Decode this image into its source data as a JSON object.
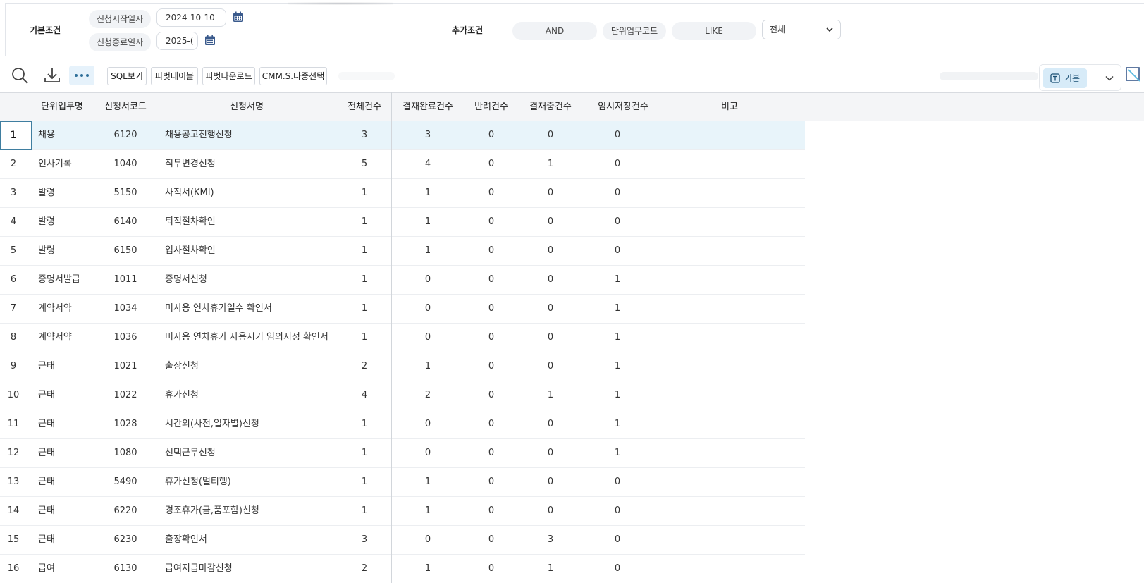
{
  "conditions": {
    "basic_title": "기본조건",
    "start_label": "신청시작일자",
    "start_value": "2024-10-10",
    "end_label": "신청종료일자",
    "end_value": "2025-(",
    "extra_title": "추가조건",
    "logic_value": "AND",
    "field_label": "단위업무코드",
    "operator_value": "LIKE",
    "select_value": "전체"
  },
  "toolbar": {
    "buttons": [
      "SQL보기",
      "피벗테이블",
      "피벗다운로드",
      "CMM.S.다중선택"
    ],
    "view_label": "기본"
  },
  "grid": {
    "headers": {
      "unit": "단위업무명",
      "code": "신청서코드",
      "name": "신청서명",
      "total": "전체건수",
      "done": "결재완료건수",
      "rejected": "반려건수",
      "in_progress": "결재중건수",
      "temp": "임시저장건수",
      "note": "비고"
    },
    "rows": [
      {
        "num": "1",
        "unit": "채용",
        "code": "6120",
        "name": "채용공고진행신청",
        "total": "3",
        "done": "3",
        "rejected": "0",
        "in_progress": "0",
        "temp": "0"
      },
      {
        "num": "2",
        "unit": "인사기록",
        "code": "1040",
        "name": "직무변경신청",
        "total": "5",
        "done": "4",
        "rejected": "0",
        "in_progress": "1",
        "temp": "0"
      },
      {
        "num": "3",
        "unit": "발령",
        "code": "5150",
        "name": "사직서(KMI)",
        "total": "1",
        "done": "1",
        "rejected": "0",
        "in_progress": "0",
        "temp": "0"
      },
      {
        "num": "4",
        "unit": "발령",
        "code": "6140",
        "name": "퇴직절차확인",
        "total": "1",
        "done": "1",
        "rejected": "0",
        "in_progress": "0",
        "temp": "0"
      },
      {
        "num": "5",
        "unit": "발령",
        "code": "6150",
        "name": "입사절차확인",
        "total": "1",
        "done": "1",
        "rejected": "0",
        "in_progress": "0",
        "temp": "0"
      },
      {
        "num": "6",
        "unit": "증명서발급",
        "code": "1011",
        "name": "증명서신청",
        "total": "1",
        "done": "0",
        "rejected": "0",
        "in_progress": "0",
        "temp": "1"
      },
      {
        "num": "7",
        "unit": "계약서약",
        "code": "1034",
        "name": "미사용 연차휴가일수 확인서",
        "total": "1",
        "done": "0",
        "rejected": "0",
        "in_progress": "0",
        "temp": "1"
      },
      {
        "num": "8",
        "unit": "계약서약",
        "code": "1036",
        "name": "미사용 연차휴가 사용시기 임의지정 확인서",
        "total": "1",
        "done": "0",
        "rejected": "0",
        "in_progress": "0",
        "temp": "1"
      },
      {
        "num": "9",
        "unit": "근태",
        "code": "1021",
        "name": "출장신청",
        "total": "2",
        "done": "1",
        "rejected": "0",
        "in_progress": "0",
        "temp": "1"
      },
      {
        "num": "10",
        "unit": "근태",
        "code": "1022",
        "name": "휴가신청",
        "total": "4",
        "done": "2",
        "rejected": "0",
        "in_progress": "1",
        "temp": "1"
      },
      {
        "num": "11",
        "unit": "근태",
        "code": "1028",
        "name": "시간외(사전,일자별)신청",
        "total": "1",
        "done": "0",
        "rejected": "0",
        "in_progress": "0",
        "temp": "1"
      },
      {
        "num": "12",
        "unit": "근태",
        "code": "1080",
        "name": "선택근무신청",
        "total": "1",
        "done": "0",
        "rejected": "0",
        "in_progress": "0",
        "temp": "1"
      },
      {
        "num": "13",
        "unit": "근태",
        "code": "5490",
        "name": "휴가신청(멀티행)",
        "total": "1",
        "done": "1",
        "rejected": "0",
        "in_progress": "0",
        "temp": "0"
      },
      {
        "num": "14",
        "unit": "근태",
        "code": "6220",
        "name": "경조휴가(금,품포함)신청",
        "total": "1",
        "done": "1",
        "rejected": "0",
        "in_progress": "0",
        "temp": "0"
      },
      {
        "num": "15",
        "unit": "근태",
        "code": "6230",
        "name": "출장확인서",
        "total": "3",
        "done": "0",
        "rejected": "0",
        "in_progress": "3",
        "temp": "0"
      },
      {
        "num": "16",
        "unit": "급여",
        "code": "6130",
        "name": "급여지급마감신청",
        "total": "2",
        "done": "1",
        "rejected": "0",
        "in_progress": "1",
        "temp": "0"
      }
    ]
  },
  "colors": {
    "accent": "#3f7ea0",
    "selected_row": "#e8f4fa",
    "chip_bg": "#d7ebf8",
    "calendar_icon": "#3a5a8c"
  }
}
